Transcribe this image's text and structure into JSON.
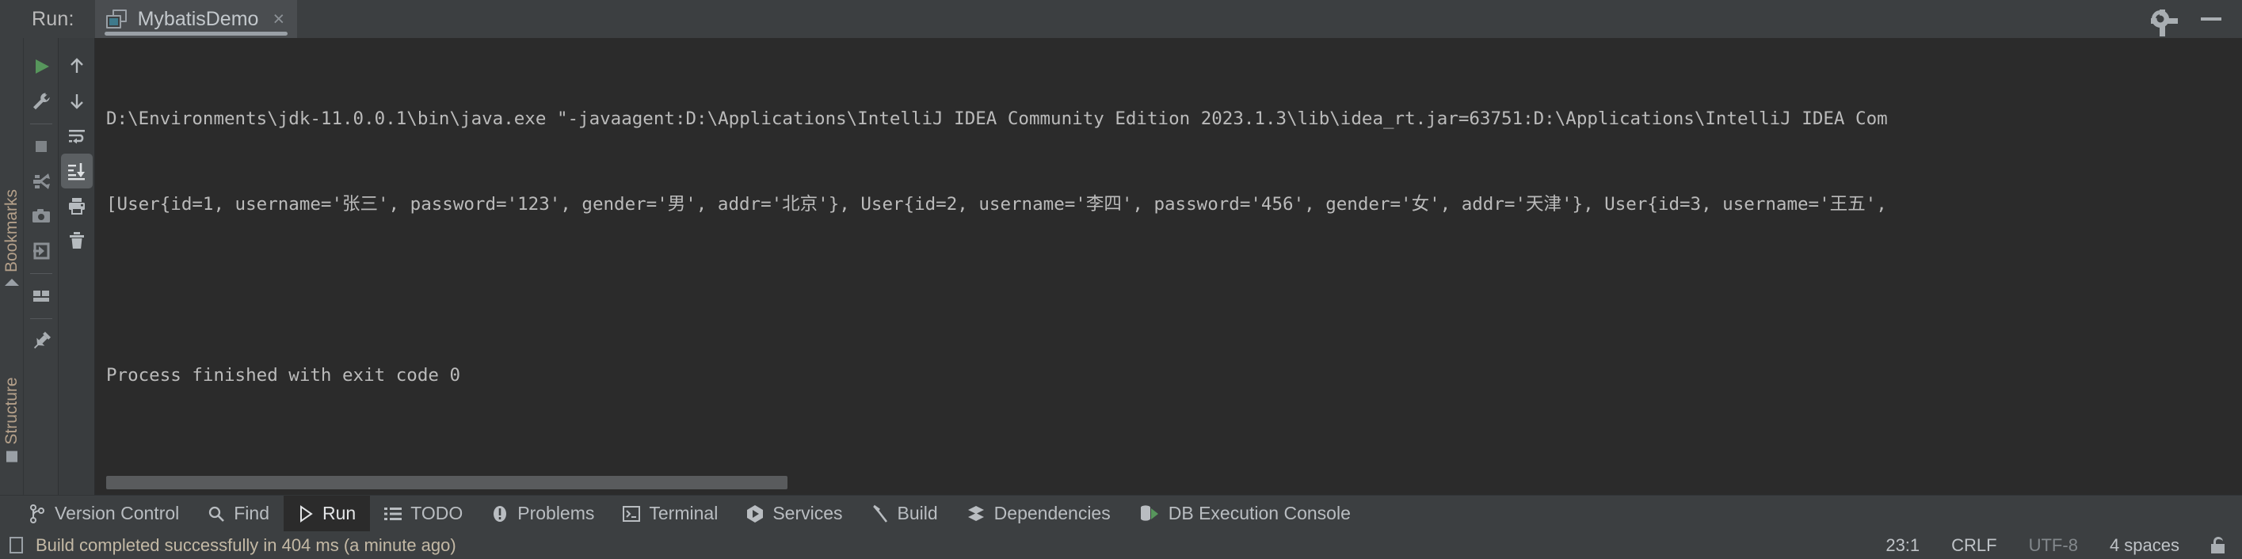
{
  "window": {
    "run_label": "Run:",
    "tab_title": "MybatisDemo",
    "tab_close": "×",
    "settings_icon": "gear-icon",
    "minimize_icon": "minimize-icon"
  },
  "left_stripe": {
    "bookmarks_label": "Bookmarks",
    "structure_label": "Structure"
  },
  "run_toolbar": {
    "items": [
      {
        "name": "rerun-button",
        "icon": "play-icon",
        "tooltip": "Rerun"
      },
      {
        "name": "edit-configurations-button",
        "icon": "wrench-icon",
        "tooltip": "Modify Run Configuration"
      },
      {
        "name": "stop-button",
        "icon": "stop-square-icon",
        "tooltip": "Stop"
      },
      {
        "name": "debug-resume-button",
        "icon": "threads-icon",
        "tooltip": "Dump Threads"
      },
      {
        "name": "screenshot-button",
        "icon": "camera-icon",
        "tooltip": "Screenshot"
      },
      {
        "name": "export-button",
        "icon": "export-arrow-icon",
        "tooltip": "Export"
      },
      {
        "name": "layout-button",
        "icon": "layout-icon",
        "tooltip": "Layout Settings"
      },
      {
        "name": "pin-tab-button",
        "icon": "pin-icon",
        "tooltip": "Pin Tab"
      }
    ]
  },
  "console_toolbar": {
    "items": [
      {
        "name": "prev-occurrence-button",
        "icon": "arrow-up-icon",
        "tooltip": "Up the Stack Trace"
      },
      {
        "name": "next-occurrence-button",
        "icon": "arrow-down-icon",
        "tooltip": "Down the Stack Trace"
      },
      {
        "name": "soft-wrap-button",
        "icon": "soft-wrap-icon",
        "tooltip": "Use Soft Wraps"
      },
      {
        "name": "scroll-to-end-button",
        "icon": "scroll-to-end-icon",
        "tooltip": "Scroll to the end",
        "active": true
      },
      {
        "name": "print-button",
        "icon": "printer-icon",
        "tooltip": "Print"
      },
      {
        "name": "clear-all-button",
        "icon": "trash-icon",
        "tooltip": "Clear All"
      }
    ]
  },
  "console": {
    "lines": [
      "D:\\Environments\\jdk-11.0.0.1\\bin\\java.exe \"-javaagent:D:\\Applications\\IntelliJ IDEA Community Edition 2023.1.3\\lib\\idea_rt.jar=63751:D:\\Applications\\IntelliJ IDEA Com",
      "[User{id=1, username='张三', password='123', gender='男', addr='北京'}, User{id=2, username='李四', password='456', gender='女', addr='天津'}, User{id=3, username='王五',",
      "",
      "Process finished with exit code 0"
    ]
  },
  "tool_window_bar": {
    "items": [
      {
        "label": "Version Control",
        "icon": "branch-icon",
        "selected": false
      },
      {
        "label": "Find",
        "icon": "search-icon",
        "selected": false
      },
      {
        "label": "Run",
        "icon": "play-triangle-icon",
        "selected": true
      },
      {
        "label": "TODO",
        "icon": "list-icon",
        "selected": false
      },
      {
        "label": "Problems",
        "icon": "warning-circle-icon",
        "selected": false
      },
      {
        "label": "Terminal",
        "icon": "terminal-icon",
        "selected": false
      },
      {
        "label": "Services",
        "icon": "services-icon",
        "selected": false
      },
      {
        "label": "Build",
        "icon": "hammer-icon",
        "selected": false
      },
      {
        "label": "Dependencies",
        "icon": "layers-icon",
        "selected": false
      },
      {
        "label": "DB Execution Console",
        "icon": "database-run-icon",
        "selected": false
      }
    ]
  },
  "status_bar": {
    "message": "Build completed successfully in 404 ms (a minute ago)",
    "caret_position": "23:1",
    "line_separator": "CRLF",
    "encoding": "UTF-8",
    "indent": "4 spaces",
    "lock_icon": "unlocked-icon"
  },
  "colors": {
    "accent_green": "#57965c",
    "console_bg": "#2b2b2b",
    "chrome_bg": "#3c3f41",
    "text": "#bbbbbb",
    "status_text": "#c4b9a5"
  }
}
